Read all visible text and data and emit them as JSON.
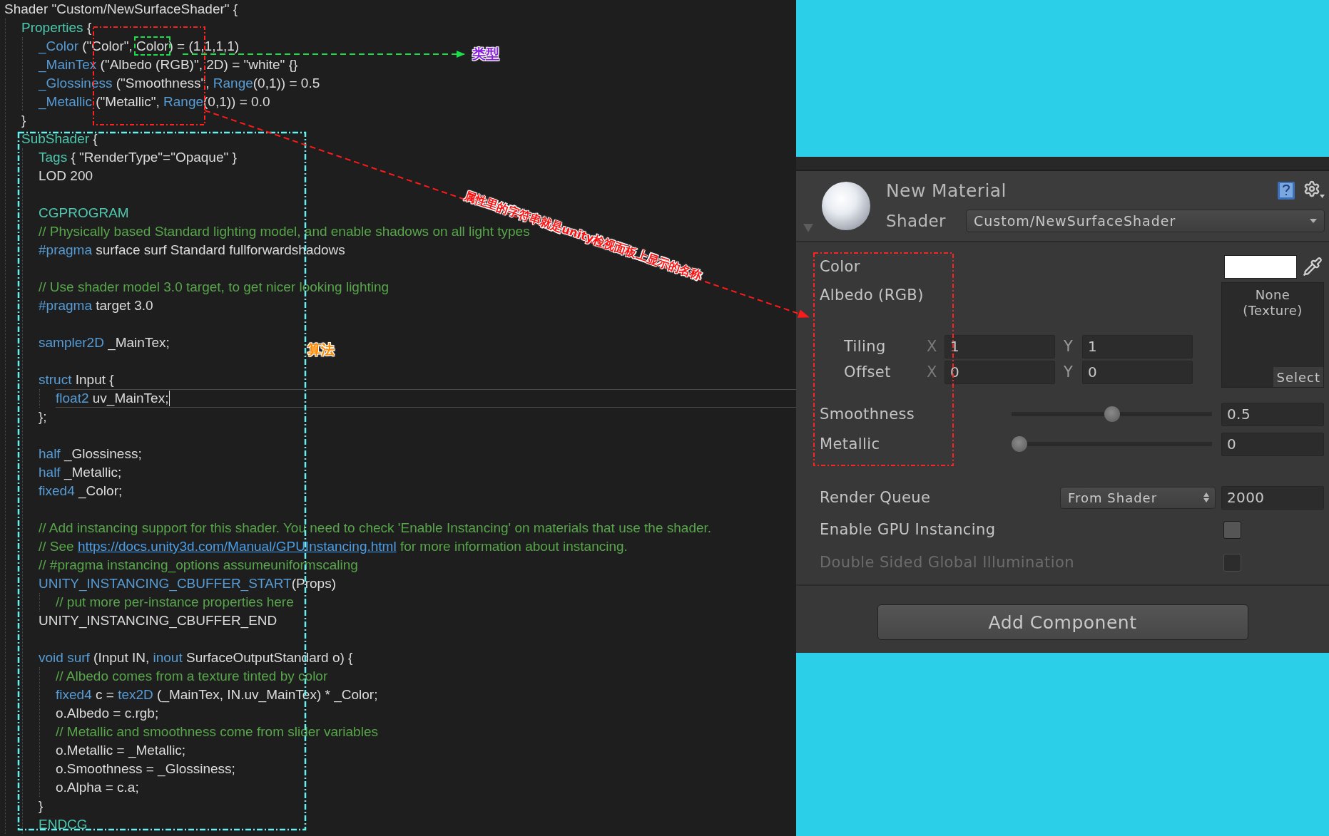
{
  "editor": {
    "lines": [
      {
        "kind": "code",
        "current": false,
        "tokens": [
          {
            "kind": "tx",
            "text": "Shader \"Custom/NewSurfaceShader\" {"
          }
        ],
        "children": [
          {
            "kind": "code",
            "current": false,
            "tokens": [
              {
                "kind": "ty",
                "text": "Properties"
              },
              {
                "kind": "tx",
                "text": " {"
              }
            ],
            "children": [
              {
                "kind": "code",
                "current": false,
                "tokens": [
                  {
                    "kind": "kw",
                    "text": "_Color"
                  },
                  {
                    "kind": "tx",
                    "text": " (\"Color\", "
                  },
                  {
                    "kind": "fr",
                    "text": "Color"
                  },
                  {
                    "kind": "tx",
                    "text": ") = (1,1,1,1)"
                  }
                ]
              },
              {
                "kind": "code",
                "current": false,
                "tokens": [
                  {
                    "kind": "kw",
                    "text": "_MainTex"
                  },
                  {
                    "kind": "tx",
                    "text": " (\"Albedo (RGB)\", 2D) = \"white\" {}"
                  }
                ]
              },
              {
                "kind": "code",
                "current": false,
                "tokens": [
                  {
                    "kind": "kw",
                    "text": "_Glossiness"
                  },
                  {
                    "kind": "tx",
                    "text": " (\"Smoothness\", "
                  },
                  {
                    "kind": "kw",
                    "text": "Range"
                  },
                  {
                    "kind": "tx",
                    "text": "(0,1)) = 0.5"
                  }
                ]
              },
              {
                "kind": "code",
                "current": false,
                "tokens": [
                  {
                    "kind": "kw",
                    "text": "_Metallic"
                  },
                  {
                    "kind": "tx",
                    "text": " (\"Metallic\", "
                  },
                  {
                    "kind": "kw",
                    "text": "Range"
                  },
                  {
                    "kind": "tx",
                    "text": "(0,1)) = 0.0"
                  }
                ]
              }
            ]
          },
          {
            "kind": "code",
            "current": false,
            "tokens": [
              {
                "kind": "tx",
                "text": "}"
              }
            ]
          },
          {
            "kind": "code",
            "current": false,
            "tokens": [
              {
                "kind": "ty",
                "text": "SubShader"
              },
              {
                "kind": "tx",
                "text": " {"
              }
            ],
            "children": [
              {
                "kind": "code",
                "current": false,
                "tokens": [
                  {
                    "kind": "ty",
                    "text": "Tags"
                  },
                  {
                    "kind": "tx",
                    "text": " { \"RenderType\"=\"Opaque\" }"
                  }
                ]
              },
              {
                "kind": "code",
                "current": false,
                "tokens": [
                  {
                    "kind": "tx",
                    "text": "LOD 200"
                  }
                ]
              },
              {
                "kind": "blank",
                "current": false
              },
              {
                "kind": "code",
                "current": false,
                "tokens": [
                  {
                    "kind": "ty",
                    "text": "CGPROGRAM"
                  }
                ]
              },
              {
                "kind": "code",
                "current": false,
                "tokens": [
                  {
                    "kind": "cm",
                    "text": "// Physically based Standard lighting model, and enable shadows on all light types"
                  }
                ]
              },
              {
                "kind": "code",
                "current": false,
                "tokens": [
                  {
                    "kind": "kw",
                    "text": "#pragma"
                  },
                  {
                    "kind": "tx",
                    "text": " surface surf Standard fullforwardshadows"
                  }
                ]
              },
              {
                "kind": "blank",
                "current": false
              },
              {
                "kind": "code",
                "current": false,
                "tokens": [
                  {
                    "kind": "cm",
                    "text": "// Use shader model 3.0 target, to get nicer looking lighting"
                  }
                ]
              },
              {
                "kind": "code",
                "current": false,
                "tokens": [
                  {
                    "kind": "kw",
                    "text": "#pragma"
                  },
                  {
                    "kind": "tx",
                    "text": " target 3.0"
                  }
                ]
              },
              {
                "kind": "blank",
                "current": false
              },
              {
                "kind": "code",
                "current": false,
                "tokens": [
                  {
                    "kind": "kw",
                    "text": "sampler2D"
                  },
                  {
                    "kind": "tx",
                    "text": " _MainTex;"
                  }
                ]
              },
              {
                "kind": "blank",
                "current": false
              },
              {
                "kind": "code",
                "current": false,
                "tokens": [
                  {
                    "kind": "kw",
                    "text": "struct"
                  },
                  {
                    "kind": "tx",
                    "text": " Input {"
                  }
                ],
                "children": [
                  {
                    "kind": "code",
                    "current": true,
                    "tokens": [
                      {
                        "kind": "kw",
                        "text": "float2"
                      },
                      {
                        "kind": "tx",
                        "text": " uv_MainTex;"
                      }
                    ]
                  }
                ]
              },
              {
                "kind": "code",
                "current": false,
                "tokens": [
                  {
                    "kind": "tx",
                    "text": "};"
                  }
                ]
              },
              {
                "kind": "blank",
                "current": false
              },
              {
                "kind": "code",
                "current": false,
                "tokens": [
                  {
                    "kind": "kw",
                    "text": "half"
                  },
                  {
                    "kind": "tx",
                    "text": " _Glossiness;"
                  }
                ]
              },
              {
                "kind": "code",
                "current": false,
                "tokens": [
                  {
                    "kind": "kw",
                    "text": "half"
                  },
                  {
                    "kind": "tx",
                    "text": " _Metallic;"
                  }
                ]
              },
              {
                "kind": "code",
                "current": false,
                "tokens": [
                  {
                    "kind": "kw",
                    "text": "fixed4"
                  },
                  {
                    "kind": "tx",
                    "text": " _Color;"
                  }
                ]
              },
              {
                "kind": "blank",
                "current": false
              },
              {
                "kind": "code",
                "current": false,
                "tokens": [
                  {
                    "kind": "cm",
                    "text": "// Add instancing support for this shader. You need to check 'Enable Instancing' on materials that use the shader."
                  }
                ]
              },
              {
                "kind": "code",
                "current": false,
                "tokens": [
                  {
                    "kind": "cm",
                    "text": "// See "
                  },
                  {
                    "kind": "ln",
                    "text": "https://docs.unity3d.com/Manual/GPUInstancing.html"
                  },
                  {
                    "kind": "cm",
                    "text": " for more information about instancing."
                  }
                ]
              },
              {
                "kind": "code",
                "current": false,
                "tokens": [
                  {
                    "kind": "cm",
                    "text": "// #pragma instancing_options assumeuniformscaling"
                  }
                ]
              },
              {
                "kind": "code",
                "current": false,
                "tokens": [
                  {
                    "kind": "kw",
                    "text": "UNITY_INSTANCING_CBUFFER_START"
                  },
                  {
                    "kind": "tx",
                    "text": "(Props)"
                  }
                ],
                "children": [
                  {
                    "kind": "code",
                    "current": false,
                    "tokens": [
                      {
                        "kind": "cm",
                        "text": "// put more per-instance properties here"
                      }
                    ]
                  }
                ]
              },
              {
                "kind": "code",
                "current": false,
                "tokens": [
                  {
                    "kind": "tx",
                    "text": "UNITY_INSTANCING_CBUFFER_END"
                  }
                ]
              },
              {
                "kind": "blank",
                "current": false
              },
              {
                "kind": "code",
                "current": false,
                "tokens": [
                  {
                    "kind": "kw",
                    "text": "void surf"
                  },
                  {
                    "kind": "tx",
                    "text": " (Input IN, "
                  },
                  {
                    "kind": "kw",
                    "text": "inout"
                  },
                  {
                    "kind": "tx",
                    "text": " SurfaceOutputStandard o) {"
                  }
                ],
                "children": [
                  {
                    "kind": "code",
                    "current": false,
                    "tokens": [
                      {
                        "kind": "cm",
                        "text": "// Albedo comes from a texture tinted by color"
                      }
                    ]
                  },
                  {
                    "kind": "code",
                    "current": false,
                    "tokens": [
                      {
                        "kind": "kw",
                        "text": "fixed4"
                      },
                      {
                        "kind": "tx",
                        "text": " c = "
                      },
                      {
                        "kind": "kw",
                        "text": "tex2D"
                      },
                      {
                        "kind": "tx",
                        "text": " (_MainTex, IN.uv_MainTex) * _Color;"
                      }
                    ]
                  },
                  {
                    "kind": "code",
                    "current": false,
                    "tokens": [
                      {
                        "kind": "tx",
                        "text": "o.Albedo = c.rgb;"
                      }
                    ]
                  },
                  {
                    "kind": "code",
                    "current": false,
                    "tokens": [
                      {
                        "kind": "cm",
                        "text": "// Metallic and smoothness come from slider variables"
                      }
                    ]
                  },
                  {
                    "kind": "code",
                    "current": false,
                    "tokens": [
                      {
                        "kind": "tx",
                        "text": "o.Metallic = _Metallic;"
                      }
                    ]
                  },
                  {
                    "kind": "code",
                    "current": false,
                    "tokens": [
                      {
                        "kind": "tx",
                        "text": "o.Smoothness = _Glossiness;"
                      }
                    ]
                  },
                  {
                    "kind": "code",
                    "current": false,
                    "tokens": [
                      {
                        "kind": "tx",
                        "text": "o.Alpha = c.a;"
                      }
                    ]
                  }
                ]
              },
              {
                "kind": "code",
                "current": false,
                "tokens": [
                  {
                    "kind": "tx",
                    "text": "}"
                  }
                ]
              },
              {
                "kind": "code",
                "current": false,
                "tokens": [
                  {
                    "kind": "ty",
                    "text": "ENDCG"
                  }
                ]
              }
            ]
          }
        ]
      }
    ]
  },
  "inspector": {
    "title": "New Material",
    "shader_label": "Shader",
    "shader": "Custom/NewSurfaceShader",
    "properties": [
      {
        "kind": "color",
        "label": "Color",
        "color": "#ffffff"
      },
      {
        "kind": "texture",
        "label": "Albedo (RGB)",
        "texture": "None (Texture)",
        "select": "Select",
        "rows": [
          {
            "label": "Tiling",
            "fields": [
              {
                "axis": "X",
                "value": "1"
              },
              {
                "axis": "Y",
                "value": "1"
              }
            ]
          },
          {
            "label": "Offset",
            "fields": [
              {
                "axis": "X",
                "value": "0"
              },
              {
                "axis": "Y",
                "value": "0"
              }
            ]
          }
        ]
      },
      {
        "kind": "slider",
        "label": "Smoothness",
        "level": 0.5,
        "value": "0.5"
      },
      {
        "kind": "slider",
        "label": "Metallic",
        "level": 0,
        "value": "0"
      }
    ],
    "render_queue": {
      "label": "Render Queue",
      "mode": "From Shader",
      "value": "2000"
    },
    "toggles": [
      {
        "label": "Enable GPU Instancing",
        "checked": false,
        "disabled": false
      },
      {
        "label": "Double Sided Global Illumination",
        "checked": false,
        "disabled": true
      }
    ],
    "add_component": "Add Component"
  },
  "annotations": {
    "type_label": "类型",
    "algorithm_label": "算法",
    "arrow_label": "属性里的字符串就是unity检视面板上显示的名称"
  }
}
